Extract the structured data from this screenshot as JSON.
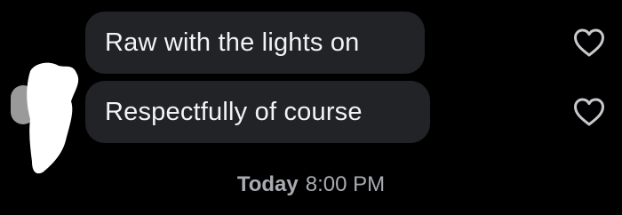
{
  "messages": [
    {
      "text": "Raw with the lights on",
      "liked": false,
      "icon": "heart-outline-icon"
    },
    {
      "text": "Respectfully of course",
      "liked": false,
      "icon": "heart-outline-icon"
    }
  ],
  "timestamp": {
    "day": "Today",
    "time": "8:00 PM"
  },
  "colors": {
    "background": "#000000",
    "bubble": "#222327",
    "bubble_text": "#f3f3f3",
    "icon": "#c8c9cd",
    "timestamp": "#a9abb0"
  }
}
